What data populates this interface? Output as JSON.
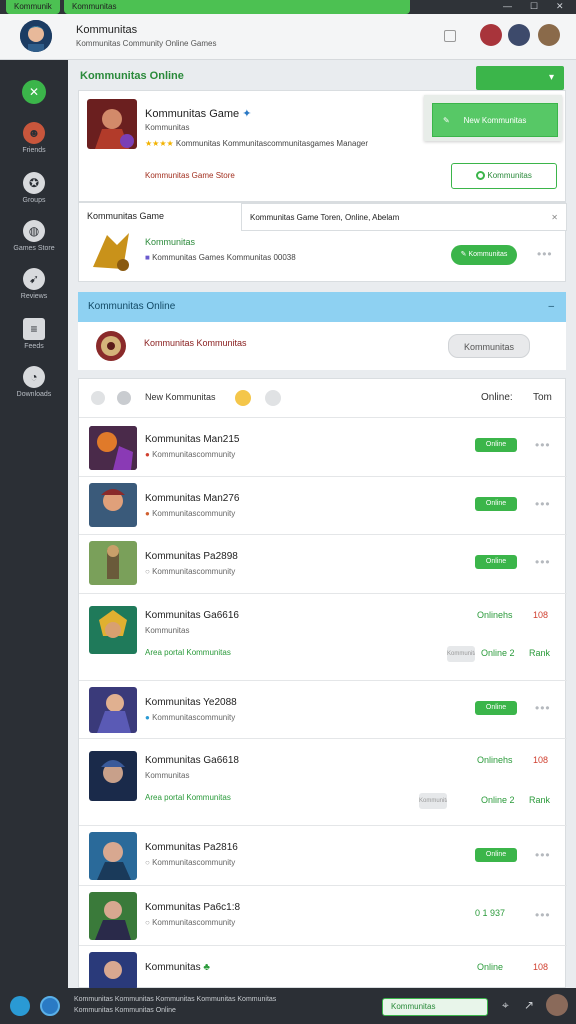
{
  "window": {
    "tab_active": "Kommunik",
    "tab_second": "Kommunitas",
    "controls": [
      "—",
      "☐",
      "✕"
    ]
  },
  "header": {
    "title": "Kommunitas",
    "subtitle": "Kommunitas Community Online Games"
  },
  "sidebar": {
    "items": [
      {
        "label": "",
        "icon": "leaf-icon"
      },
      {
        "label": "Friends",
        "icon": "user-icon"
      },
      {
        "label": "Groups",
        "icon": "group-icon"
      },
      {
        "label": "Games Store",
        "icon": "game-icon"
      },
      {
        "label": "Reviews",
        "icon": "megaphone-icon"
      },
      {
        "label": "Feeds",
        "icon": "list-icon"
      },
      {
        "label": "Downloads",
        "icon": "download-icon"
      }
    ]
  },
  "section1": {
    "title": "Kommunitas Online",
    "dropdown": "▾"
  },
  "featured": {
    "title": "Kommunitas Game",
    "subtitle": "Kommunitas",
    "rating_stars": "★★★★",
    "rating_text": "Kommunitas  Kommunitascommunitasgames Manager",
    "link": "Kommunitas Game Store",
    "popup_button": "New Kommunitas",
    "outline_button": "Kommunitas"
  },
  "second_game": {
    "label": "Kommunitas Game",
    "banner": "Kommunitas Game Toren, Online, Abelam",
    "name": "Kommunitas",
    "desc": "Kommunitas Games Kommunitas 00038",
    "button": "Kommunitas"
  },
  "online_section": {
    "title": "Kommunitas Online",
    "item_name": "Kommunitas Kommunitas",
    "button": "Kommunitas"
  },
  "list": {
    "filter_label": "New Kommunitas",
    "col_online": "Online:",
    "col_total": "Tom",
    "rows": [
      {
        "name": "Kommunitas Man215",
        "sub": "Kommunitascommunity",
        "status": "Online",
        "type": "button"
      },
      {
        "name": "Kommunitas Man276",
        "sub": "Kommunitascommunity",
        "status": "Online",
        "type": "button"
      },
      {
        "name": "Kommunitas Pa2898",
        "sub": "Kommunitascommunity",
        "status": "Online",
        "type": "button"
      },
      {
        "name": "Kommunitas Ga6616",
        "sub": "Kommunitas",
        "extra": "Area portal Kommunitas",
        "status": "Onlinehs",
        "count": "108",
        "tag": "Kommunitas",
        "score": "Online 2",
        "rank": "Rank",
        "type": "expanded"
      },
      {
        "name": "Kommunitas Ye2088",
        "sub": "Kommunitascommunity",
        "status": "Online",
        "type": "button"
      },
      {
        "name": "Kommunitas Ga6618",
        "sub": "Kommunitas",
        "extra": "Area portal Kommunitas",
        "status": "Onlinehs",
        "count": "108",
        "tag": "Kommunitas",
        "score": "Online 2",
        "rank": "Rank",
        "type": "expanded"
      },
      {
        "name": "Kommunitas Pa2816",
        "sub": "Kommunitascommunity",
        "status": "Online",
        "type": "button"
      },
      {
        "name": "Kommunitas Pa6c1:8",
        "sub": "Kommunitascommunity",
        "status": "0 1 937",
        "type": "text"
      },
      {
        "name": "Kommunitas",
        "sub": "",
        "status": "Online",
        "count": "108",
        "type": "last"
      }
    ]
  },
  "footer": {
    "text1": "Kommunitas Kommunitas Kommunitas Kommunitas Kommunitas",
    "text2": "Kommunitas Kommunitas Online",
    "search_placeholder": "Kommunitas"
  }
}
